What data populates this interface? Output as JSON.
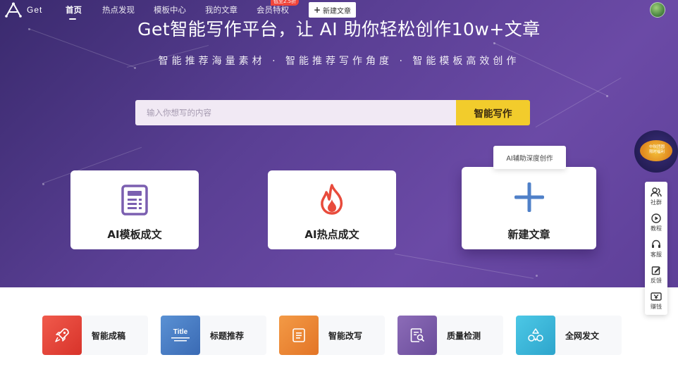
{
  "app": {
    "logo_text": "Get"
  },
  "nav": {
    "items": [
      {
        "label": "首页"
      },
      {
        "label": "热点发现"
      },
      {
        "label": "模板中心"
      },
      {
        "label": "我的文章"
      },
      {
        "label": "会员特权"
      }
    ],
    "vip_badge": "低至2.5折",
    "new_article_label": "新建文章"
  },
  "hero": {
    "title": "Get智能写作平台，让 AI 助你轻松创作10w+文章",
    "subtitle": "智能推荐海量素材 · 智能推荐写作角度 · 智能模板高效创作"
  },
  "search": {
    "placeholder": "输入你想写的内容",
    "value": "",
    "button_label": "智能写作"
  },
  "cards": [
    {
      "label": "AI模板成文",
      "icon": "template-document-icon"
    },
    {
      "label": "AI热点成文",
      "icon": "flame-icon"
    },
    {
      "label": "新建文章",
      "icon": "plus-icon"
    }
  ],
  "tooltip": "AI辅助深度创作",
  "promo": {
    "text": "中秋团圆\n限时福利"
  },
  "side_panel": [
    {
      "label": "社群",
      "icon": "community-icon"
    },
    {
      "label": "教程",
      "icon": "play-icon"
    },
    {
      "label": "客服",
      "icon": "headset-icon"
    },
    {
      "label": "反馈",
      "icon": "feedback-icon"
    },
    {
      "label": "赚钱",
      "icon": "earn-icon"
    }
  ],
  "features": [
    {
      "label": "智能成稿",
      "icon": "rocket-icon",
      "color": "#e8453c"
    },
    {
      "label": "标题推荐",
      "icon": "title-icon",
      "color": "#4a7fc4",
      "tile_text": "Title"
    },
    {
      "label": "智能改写",
      "icon": "rewrite-icon",
      "color": "#ef8a34"
    },
    {
      "label": "质量检测",
      "icon": "quality-check-icon",
      "color": "#7a5ba8"
    },
    {
      "label": "全网发文",
      "icon": "publish-icon",
      "color": "#3db8d8"
    }
  ],
  "colors": {
    "hero_purple": "#5a3f94",
    "accent_yellow": "#f2cc2c",
    "flame_red": "#e84b3c",
    "plus_blue": "#4f80c8"
  }
}
